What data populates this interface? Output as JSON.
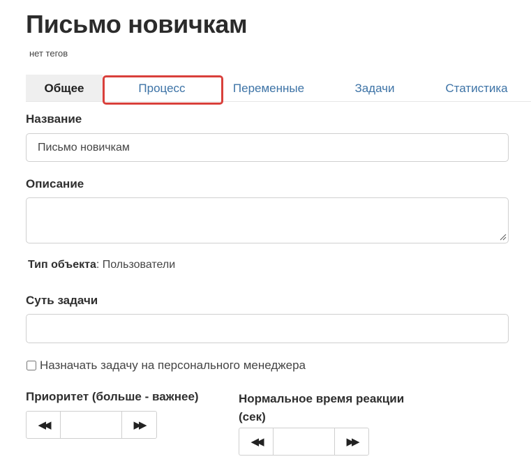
{
  "page": {
    "title": "Письмо новичкам",
    "tags": "нет тегов"
  },
  "tabs": [
    {
      "label": "Общее",
      "active": true
    },
    {
      "label": "Процесс",
      "active": false
    },
    {
      "label": "Переменные",
      "active": false
    },
    {
      "label": "Задачи",
      "active": false
    },
    {
      "label": "Статистика",
      "active": false
    }
  ],
  "form": {
    "name_label": "Название",
    "name_value": "Письмо новичкам",
    "description_label": "Описание",
    "description_value": "",
    "object_type_label": "Тип объекта",
    "object_type_separator": ":",
    "object_type_value": " Пользователи",
    "essence_label": "Суть задачи",
    "essence_value": "",
    "assign_manager_label": "Назначать задачу на персонального менеджера",
    "assign_manager_checked": false,
    "priority_label": "Приоритет (больше - важнее)",
    "priority_value": "",
    "reaction_label": "Нормальное время реакции (сек)",
    "reaction_value": "",
    "decrement_glyph": "◀◀",
    "increment_glyph": "▶▶"
  },
  "highlight_color": "#d9403b",
  "accent_color": "#3d73a6"
}
